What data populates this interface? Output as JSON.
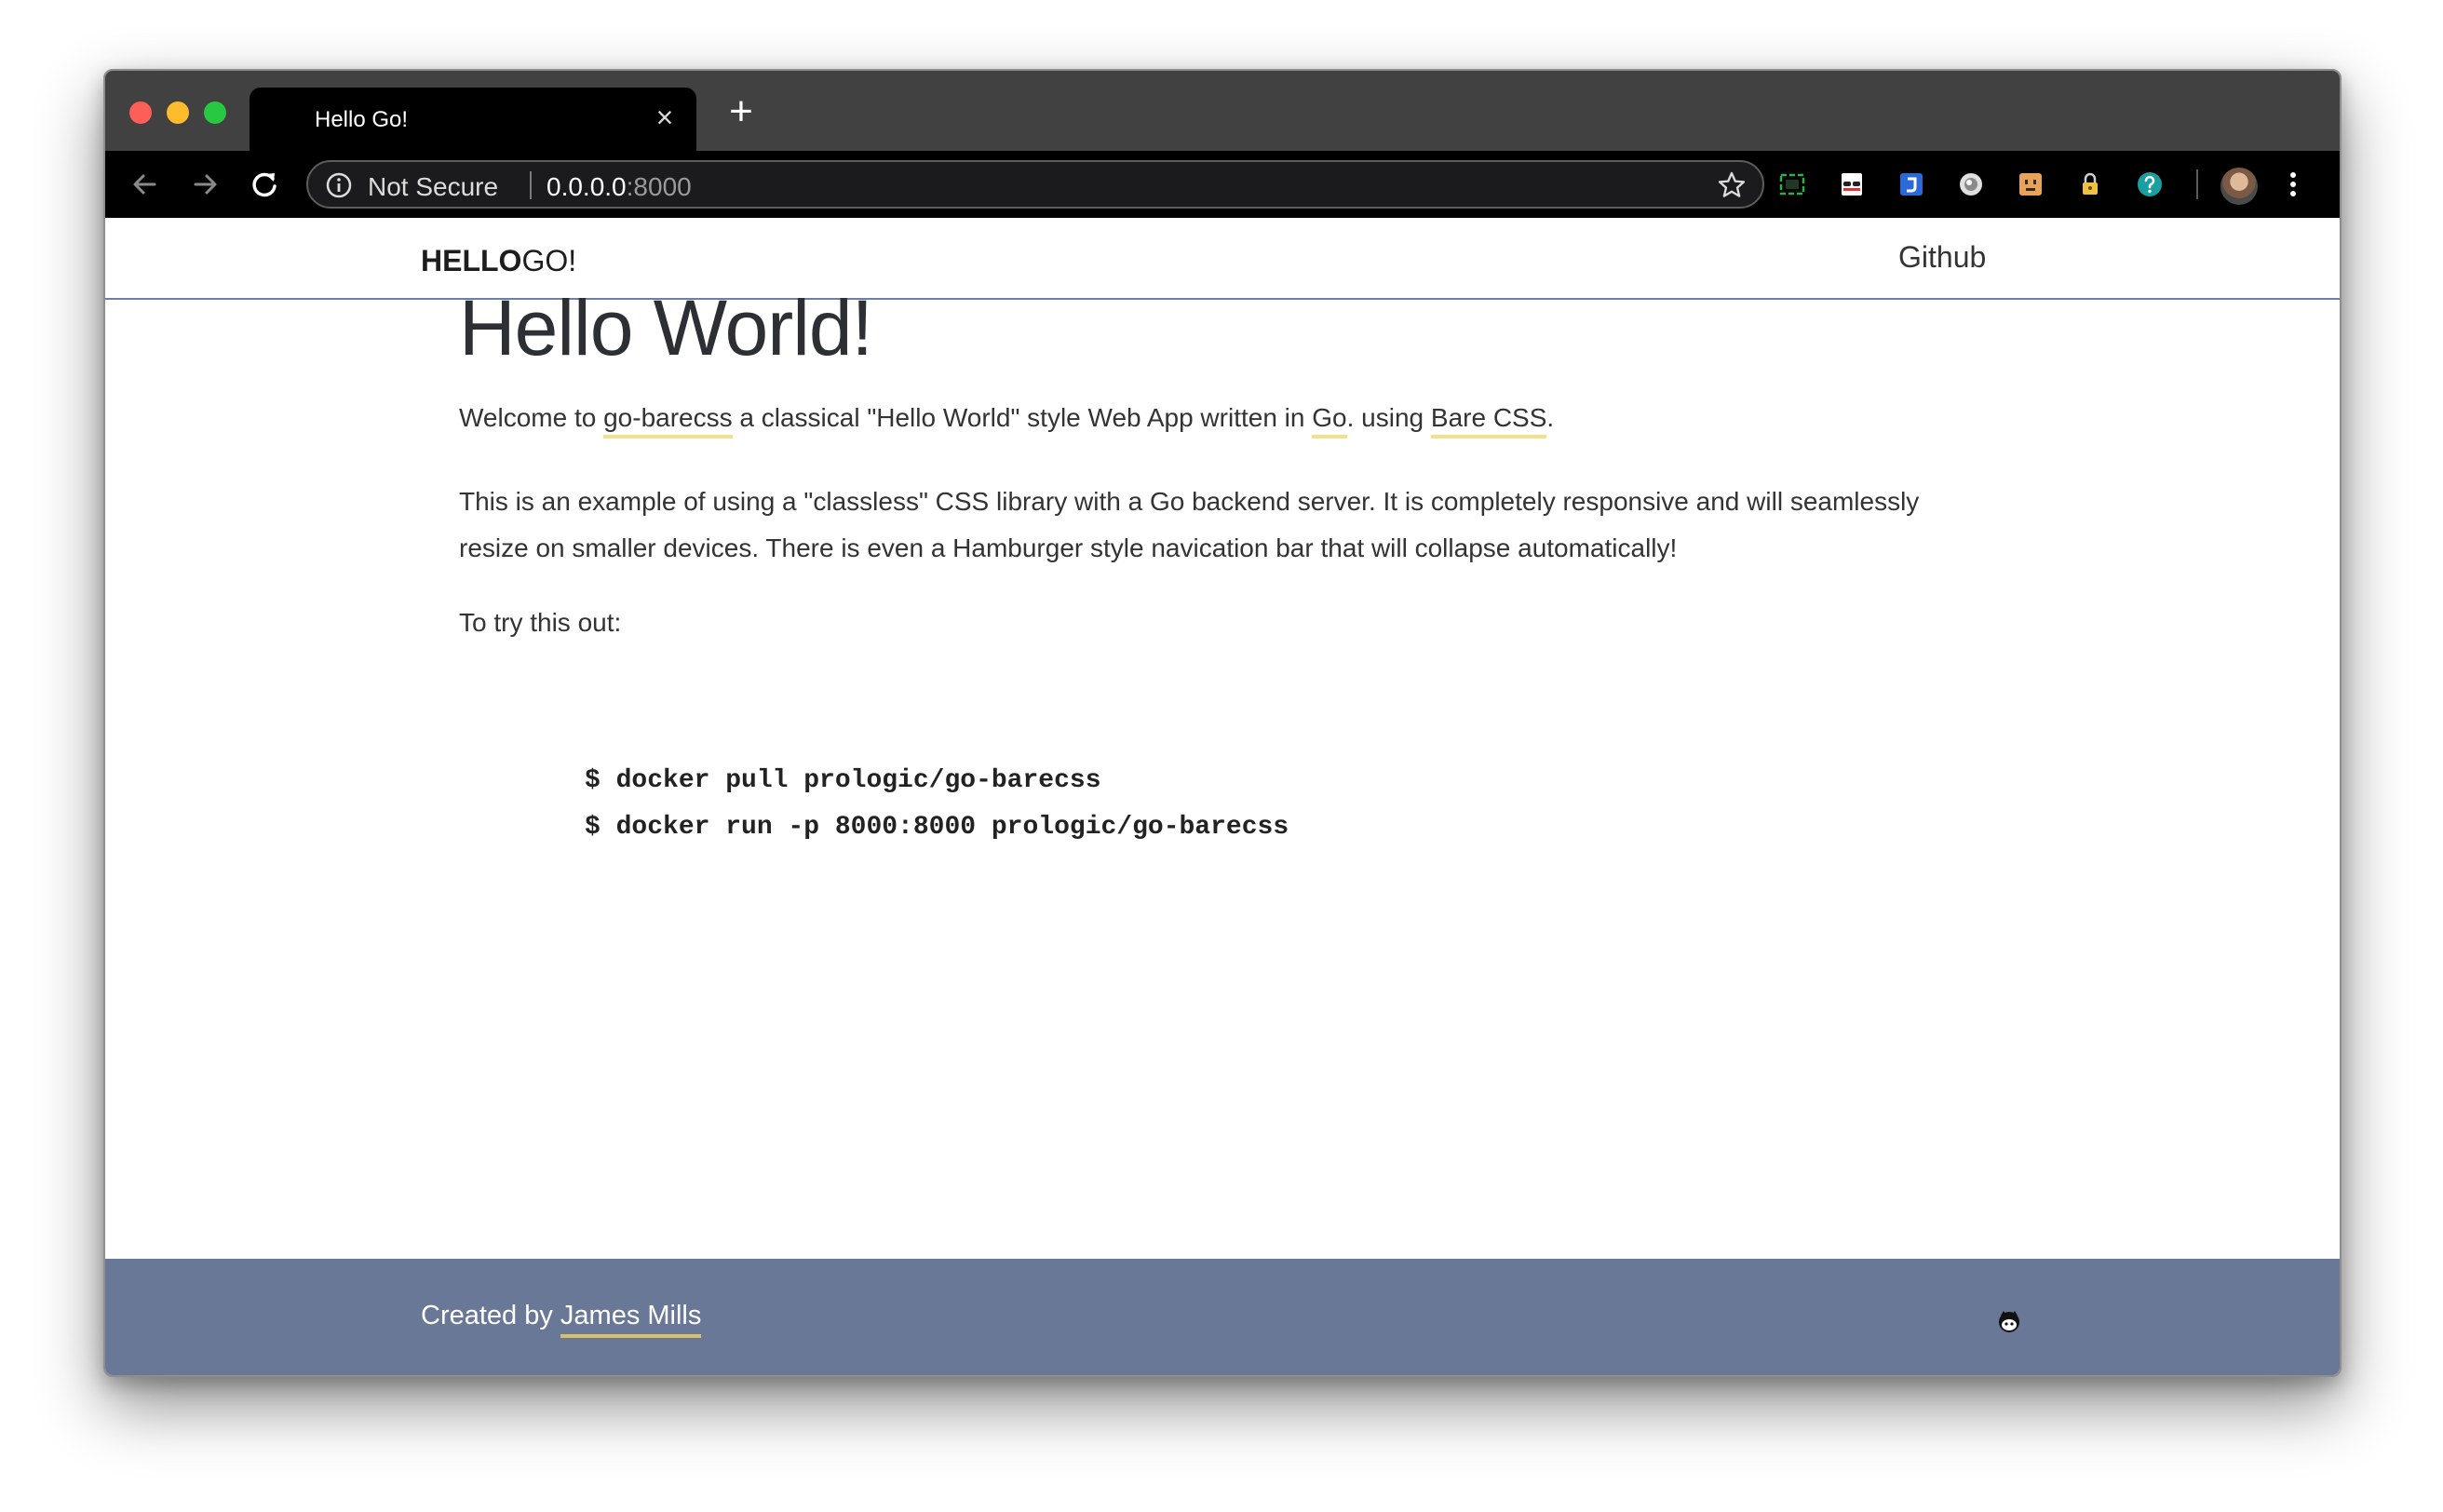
{
  "browser": {
    "tab_title": "Hello Go!",
    "tab_close": "×",
    "new_tab": "+",
    "security_label": "Not Secure",
    "url_host": "0.0.0.0",
    "url_port": ":8000",
    "icons": [
      "back-arrow-icon",
      "forward-arrow-icon",
      "reload-icon",
      "info-icon",
      "star-icon",
      "screenshot-extension-icon",
      "incognito-extension-icon",
      "jira-extension-icon",
      "circle-extension-icon",
      "face-extension-icon",
      "lock-extension-icon",
      "help-extension-icon",
      "avatar",
      "kebab-menu-icon"
    ]
  },
  "site": {
    "brand_bold": "HELLO",
    "brand_rest": "GO!",
    "nav_link": "Github"
  },
  "main": {
    "heading": "Hello World!",
    "p1": {
      "before": "Welcome to ",
      "link1": "go-barecss",
      "middle": " a classical \"Hello World\" style Web App written in ",
      "link2": "Go",
      "middle2": ". using ",
      "link3": "Bare CSS",
      "after": "."
    },
    "p2": "This is an example of using a \"classless\" CSS library with a Go backend server. It is completely responsive and will seamlessly resize on smaller devices. There is even a Hamburger style navication bar that will collapse automatically!",
    "p3": "To try this out:",
    "code_lines": [
      "$ docker pull prologic/go-barecss",
      "$ docker run -p 8000:8000 prologic/go-barecss"
    ]
  },
  "footer": {
    "created_by": "Created by ",
    "author": "James Mills",
    "icon": "github-icon"
  },
  "colors": {
    "footer_bg": "#6a7898",
    "link_underline": "#f5e08a",
    "nav_border": "#6f7f9f"
  }
}
